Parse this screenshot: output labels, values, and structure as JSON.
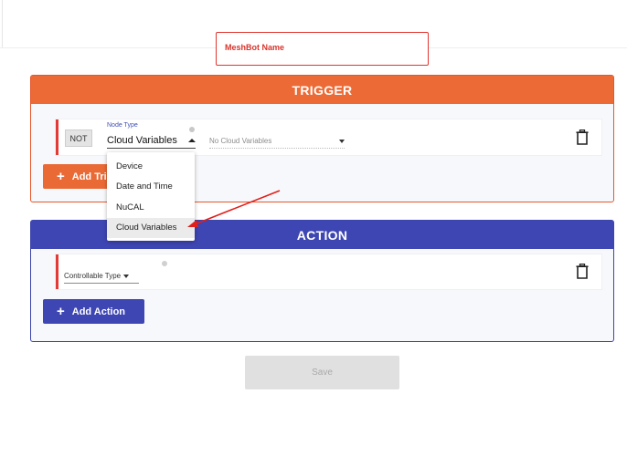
{
  "meshbot": {
    "name_placeholder": "MeshBot Name"
  },
  "trigger": {
    "title": "TRIGGER",
    "not_label": "NOT",
    "node_type_label": "Node Type",
    "node_type_value": "Cloud Variables",
    "cloud_variables_placeholder": "No Cloud Variables",
    "add_label": "Add Tri"
  },
  "dropdown": {
    "items": [
      {
        "label": "Device"
      },
      {
        "label": "Date and Time"
      },
      {
        "label": "NuCAL"
      },
      {
        "label": "Cloud Variables"
      }
    ],
    "selected_index": 3
  },
  "action": {
    "title": "ACTION",
    "controllable_type_label": "Controllable Type",
    "add_label": "Add Action"
  },
  "footer": {
    "save_label": "Save"
  },
  "colors": {
    "trigger_accent": "#ec6a35",
    "action_accent": "#3e46b3",
    "row_marker": "#e23a37",
    "annotation_arrow": "#e0201b"
  },
  "icons": {
    "trash": "trash-icon",
    "plus": "plus-icon",
    "info": "info-icon"
  }
}
